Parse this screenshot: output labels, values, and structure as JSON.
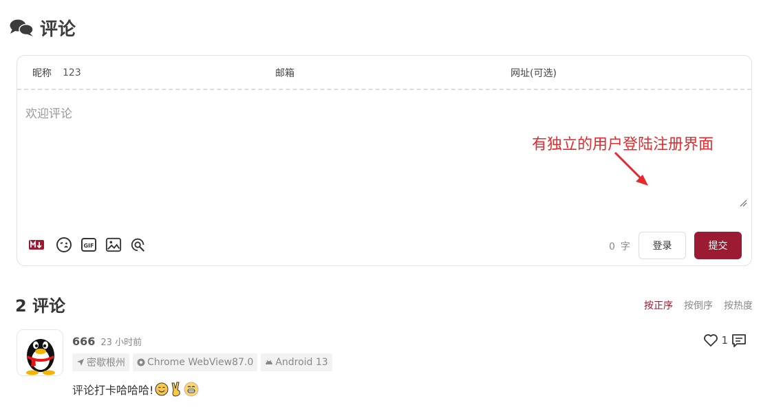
{
  "section": {
    "title": "评论"
  },
  "form": {
    "nick_label": "昵称",
    "nick_value": "123",
    "mail_label": "邮箱",
    "url_label": "网址(可选)",
    "textarea_placeholder": "欢迎评论",
    "word_count": "0",
    "word_unit": "字",
    "login_label": "登录",
    "submit_label": "提交",
    "toolbar_icons": [
      "markdown-icon",
      "emoji-icon",
      "gif-icon",
      "image-icon",
      "preview-icon"
    ]
  },
  "annotation": {
    "text": "有独立的用户登陆注册界面"
  },
  "comments_header": {
    "count_title": "2 评论",
    "sort_options": [
      "按正序",
      "按倒序",
      "按热度"
    ],
    "active_sort": "按正序"
  },
  "comment": {
    "nick": "666",
    "time": "23 小时前",
    "location": "密歇根州",
    "browser": "Chrome WebView87.0",
    "os": "Android 13",
    "text": "评论打卡哈哈哈!",
    "like_count": "1"
  },
  "colors": {
    "accent": "#9a1b32",
    "annotation": "#e5292d"
  }
}
